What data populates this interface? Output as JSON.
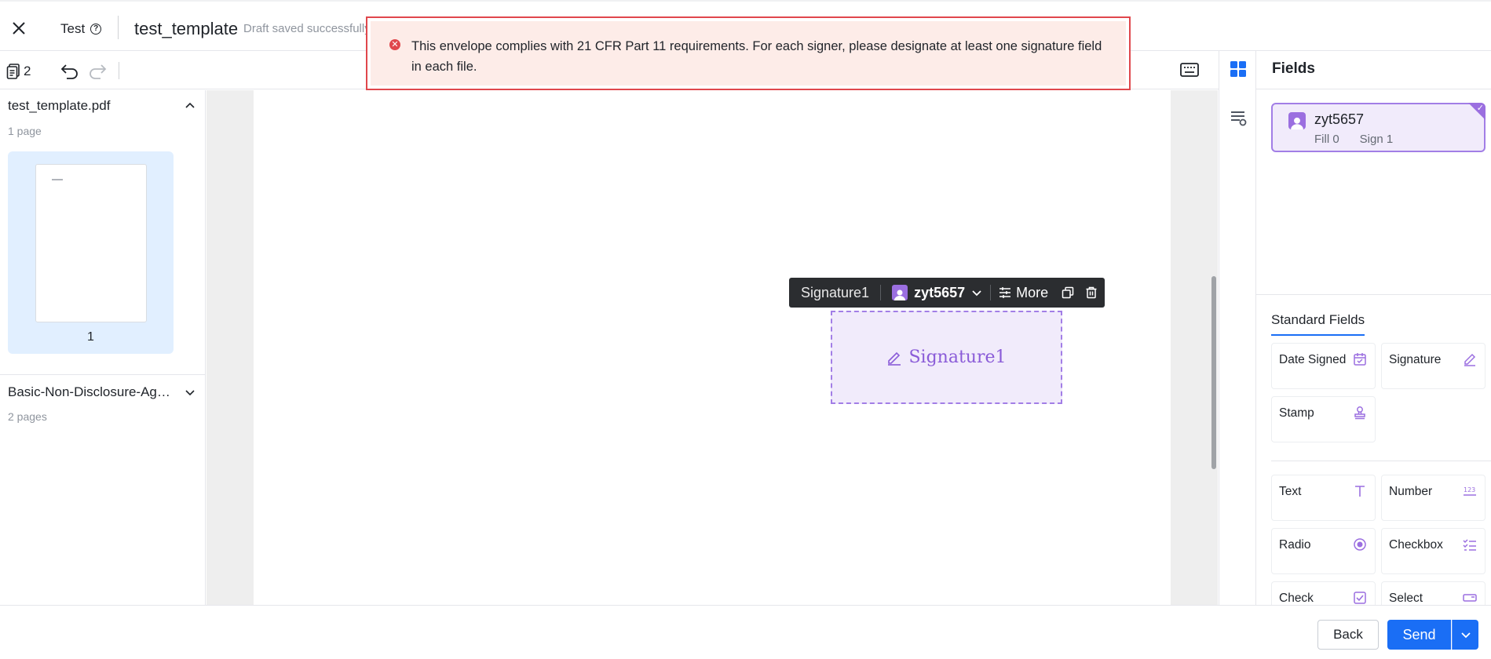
{
  "header": {
    "template_type": "Test",
    "template_name": "test_template",
    "draft_status": "Draft saved successfully"
  },
  "toast": {
    "message": "This envelope complies with 21 CFR Part 11 requirements. For each signer, please designate at least one signature field in each file.",
    "type": "error"
  },
  "toolbar": {
    "document_count": "2"
  },
  "documents": [
    {
      "name": "test_template.pdf",
      "pages": "1 page",
      "expanded": true,
      "thumbnail_page": "1"
    },
    {
      "name": "Basic-Non-Disclosure-Agreement",
      "pages": "2 pages",
      "expanded": false
    }
  ],
  "canvas": {
    "field_toolbar": {
      "field_label": "Signature1",
      "signer": "zyt5657",
      "more_label": "More"
    },
    "signature_field": {
      "label": "Signature1"
    }
  },
  "right_panel": {
    "title": "Fields",
    "signer": {
      "name": "zyt5657",
      "fill": "Fill 0",
      "sign": "Sign 1"
    },
    "standard_fields_title": "Standard Fields",
    "signature_fields": [
      {
        "label": "Date Signed",
        "icon": "calendar-icon"
      },
      {
        "label": "Signature",
        "icon": "pen-icon"
      },
      {
        "label": "Stamp",
        "icon": "stamp-icon"
      }
    ],
    "data_fields": [
      {
        "label": "Text",
        "icon": "text-icon"
      },
      {
        "label": "Number",
        "icon": "number-icon"
      },
      {
        "label": "Radio",
        "icon": "radio-icon"
      },
      {
        "label": "Checkbox",
        "icon": "checkbox-list-icon"
      },
      {
        "label": "Check",
        "icon": "check-icon"
      },
      {
        "label": "Select",
        "icon": "select-icon"
      }
    ]
  },
  "footer": {
    "back_label": "Back",
    "send_label": "Send"
  },
  "colors": {
    "accent_blue": "#1a6ef5",
    "signer_purple": "#9b6fe0",
    "error_red": "#e0474c",
    "error_bg": "#fdece8"
  }
}
